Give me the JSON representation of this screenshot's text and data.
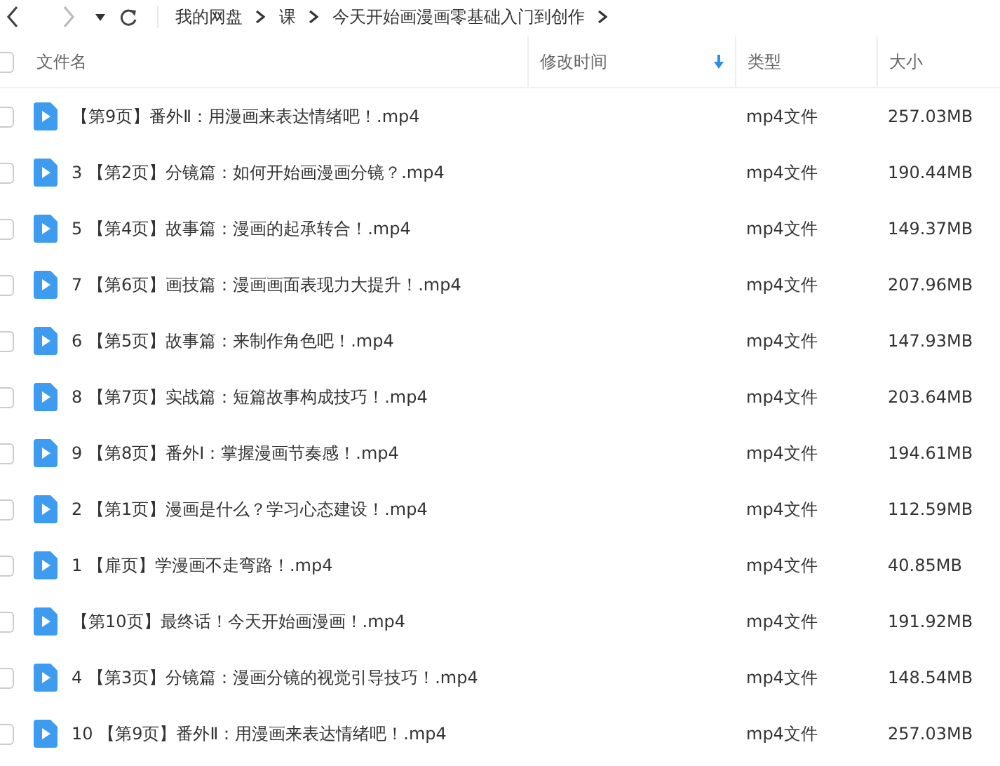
{
  "breadcrumb": [
    "我的网盘",
    "课",
    "今天开始画漫画零基础入门到创作"
  ],
  "table": {
    "select_all": {
      "checked": false
    },
    "columns": [
      {
        "label": "文件名",
        "sorted": false
      },
      {
        "label": "修改时间",
        "sorted": true
      },
      {
        "label": "类型",
        "sorted": false
      },
      {
        "label": "大小",
        "sorted": false
      }
    ],
    "rows": [
      {
        "name": "【第9页】番外Ⅱ：用漫画来表达情绪吧！.mp4",
        "type": "mp4文件",
        "size": "257.03MB",
        "checked": false
      },
      {
        "name": "3 【第2页】分镜篇：如何开始画漫画分镜？.mp4",
        "type": "mp4文件",
        "size": "190.44MB",
        "checked": false
      },
      {
        "name": "5 【第4页】故事篇：漫画的起承转合！.mp4",
        "type": "mp4文件",
        "size": "149.37MB",
        "checked": false
      },
      {
        "name": "7 【第6页】画技篇：漫画画面表现力大提升！.mp4",
        "type": "mp4文件",
        "size": "207.96MB",
        "checked": false
      },
      {
        "name": "6 【第5页】故事篇：来制作角色吧！.mp4",
        "type": "mp4文件",
        "size": "147.93MB",
        "checked": false
      },
      {
        "name": "8 【第7页】实战篇：短篇故事构成技巧！.mp4",
        "type": "mp4文件",
        "size": "203.64MB",
        "checked": false
      },
      {
        "name": "9 【第8页】番外Ⅰ：掌握漫画节奏感！.mp4",
        "type": "mp4文件",
        "size": "194.61MB",
        "checked": false
      },
      {
        "name": "2 【第1页】漫画是什么？学习心态建设！.mp4",
        "type": "mp4文件",
        "size": "112.59MB",
        "checked": false
      },
      {
        "name": "1 【扉页】学漫画不走弯路！.mp4",
        "type": "mp4文件",
        "size": "40.85MB",
        "checked": false
      },
      {
        "name": "【第10页】最终话！今天开始画漫画！.mp4",
        "type": "mp4文件",
        "size": "191.92MB",
        "checked": false
      },
      {
        "name": "4 【第3页】分镜篇：漫画分镜的视觉引导技巧！.mp4",
        "type": "mp4文件",
        "size": "148.54MB",
        "checked": false
      },
      {
        "name": "10 【第9页】番外Ⅱ：用漫画来表达情绪吧！.mp4",
        "type": "mp4文件",
        "size": "257.03MB",
        "checked": false
      }
    ]
  }
}
